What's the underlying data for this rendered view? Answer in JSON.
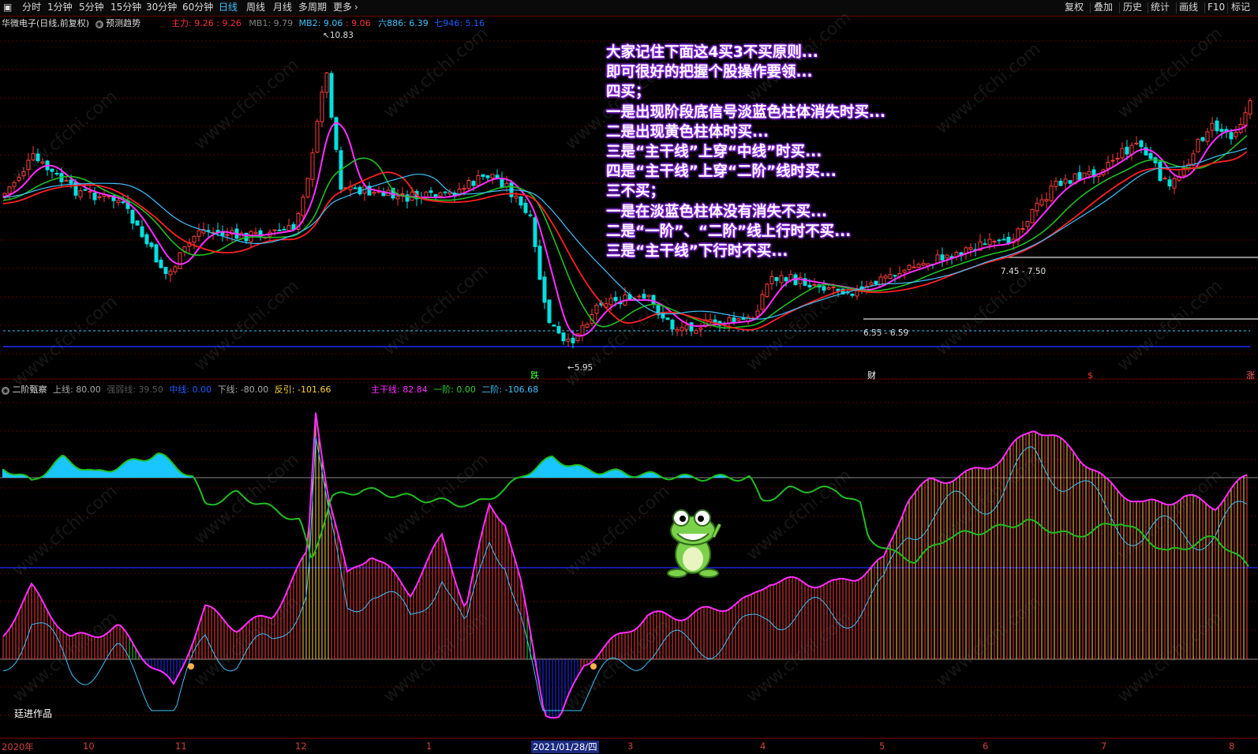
{
  "toolbar": {
    "periods": [
      "分时",
      "1分钟",
      "5分钟",
      "15分钟",
      "30分钟",
      "60分钟",
      "日线",
      "周线",
      "月线",
      "多周期",
      "更多"
    ],
    "active_period": "日线",
    "right_items": [
      "复权",
      "叠加",
      "历史",
      "统计",
      "画线",
      "F10",
      "标记"
    ]
  },
  "main_panel": {
    "stock_title": "华微电子(日线,前复权)",
    "predict_label": "预测趋势",
    "legend": [
      {
        "name": "主力",
        "value": "9.26",
        "extra": "9.26",
        "color": "#ff3030"
      },
      {
        "name": "MB1",
        "value": "9.79",
        "color": "#808080"
      },
      {
        "name": "MB2",
        "value": "9.06",
        "extra": "9.06",
        "color": "#3ec3ff"
      },
      {
        "name": "六886",
        "value": "6.39",
        "color": "#3ec3ff"
      },
      {
        "name": "七946",
        "value": "5.16",
        "color": "#1e5cff"
      }
    ],
    "high_label": "10.83",
    "low_label": "5.95",
    "range_label_1": "7.45 - 7.50",
    "range_label_2": "6.55 - 6.59",
    "signals": [
      {
        "text": "跌",
        "color": "#3cff3c"
      },
      {
        "text": "财",
        "color": "#ffffff"
      },
      {
        "text": "$",
        "color": "#ff3030"
      },
      {
        "text": "涨",
        "color": "#ff6060"
      }
    ]
  },
  "annotation": {
    "lines": [
      "大家记住下面这4买3不买原则...",
      "即可很好的把握个股操作要领...",
      "四买；",
      "一是出现阶段底信号淡蓝色柱体消失时买...",
      "二是出现黄色柱体时买...",
      "三是“主干线”上穿“中线”时买...",
      "四是“主干线”上穿“二阶”线时买...",
      "三不买；",
      "一是在淡蓝色柱体没有消失不买...",
      "二是“一阶”、“二阶”线上行时不买...",
      "三是“主干线”下行时不买..."
    ]
  },
  "sub_panel": {
    "title": "二阶甄察",
    "legend": [
      {
        "name": "上线",
        "value": "80.00",
        "color": "#aaaaaa"
      },
      {
        "name": "强弱线",
        "value": "39.50",
        "color": "#555555"
      },
      {
        "name": "中线",
        "value": "0.00",
        "color": "#1e5cff"
      },
      {
        "name": "下线",
        "value": "-80.00",
        "color": "#aaaaaa"
      },
      {
        "name": "反引",
        "value": "-101.66",
        "color": "#ffd23c"
      },
      {
        "name": "主干线",
        "value": "82.84",
        "color": "#ff2dff"
      },
      {
        "name": "一阶",
        "value": "0.00",
        "color": "#2fd12f"
      },
      {
        "name": "二阶",
        "value": "-106.68",
        "color": "#3ec3ff"
      }
    ],
    "author": "廷进作品"
  },
  "x_axis": {
    "labels": [
      "2020年",
      "10",
      "11",
      "12",
      "1",
      "2021/01/28/四",
      "3",
      "4",
      "5",
      "6",
      "7",
      "8"
    ],
    "selected": "2021/01/28/四"
  },
  "watermark": "www.cfchi.com",
  "colors": {
    "up": "#ff3b3b",
    "down": "#00e0e0",
    "bg": "#000000",
    "grid": "#5a0000",
    "ma_pink": "#ff2dff",
    "ma_green": "#1fbf1f",
    "ma_red": "#ff2020",
    "ma_blue": "#3ec3ff"
  },
  "icons": {
    "frog": "frog-mascot-icon",
    "menu": "panel-menu-icon"
  }
}
